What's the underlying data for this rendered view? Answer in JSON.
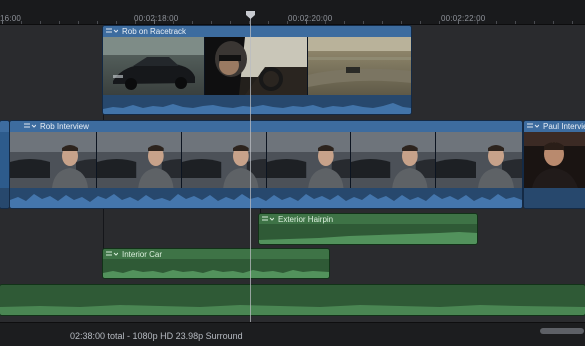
{
  "ruler": {
    "timecodes": [
      "16:00",
      "00:02:18:00",
      "00:02:20:00",
      "00:02:22:00"
    ]
  },
  "clips": {
    "video_top": {
      "title": "Rob on Racetrack"
    },
    "primary": {
      "title": "Rob Interview"
    },
    "next_clip": {
      "title": "Paul Intervie"
    },
    "audio_hairpin": {
      "title": "Exterior Hairpin"
    },
    "audio_interior": {
      "title": "Interior Car"
    }
  },
  "status": {
    "summary": "02:38:00 total - 1080p HD 23.98p Surround"
  },
  "colors": {
    "video_clip": "#3d6c9f",
    "audio_clip": "#3e7346",
    "background": "#2a2b2e"
  }
}
